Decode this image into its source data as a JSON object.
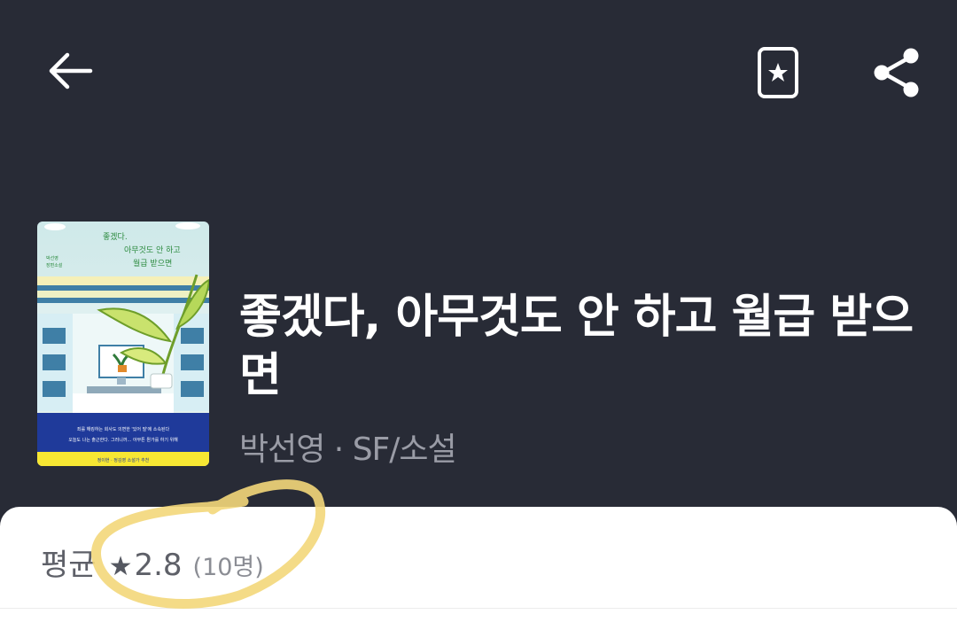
{
  "header": {
    "back_icon": "arrow-left-icon",
    "bookmark_icon": "bookmark-star-icon",
    "share_icon": "share-icon"
  },
  "book": {
    "title": "좋겠다, 아무것도 안 하고 월급 받으면",
    "meta": "박선영 · SF/소설"
  },
  "cover": {
    "title_line1": "좋겠다.",
    "title_line2": "아무것도 안 하고",
    "title_line3": "월급 받으면",
    "author": "박선영",
    "genre": "장편소설",
    "blurb1": "죄를 해킹하는 회사도 의변한 '있어 빌'에 소속된다",
    "blurb2": "오늘도 나는 출근한다. 그러니까… 아무튼 뭔가를 하기 위해",
    "recommend": "정이현 · 정김영 소설가 추천"
  },
  "rating": {
    "label": "평균",
    "star": "★",
    "value": "2.8",
    "count": "(10명)"
  },
  "colors": {
    "header_bg": "#282b36",
    "sheet_bg": "#ffffff",
    "annotation": "#f3d77a"
  }
}
